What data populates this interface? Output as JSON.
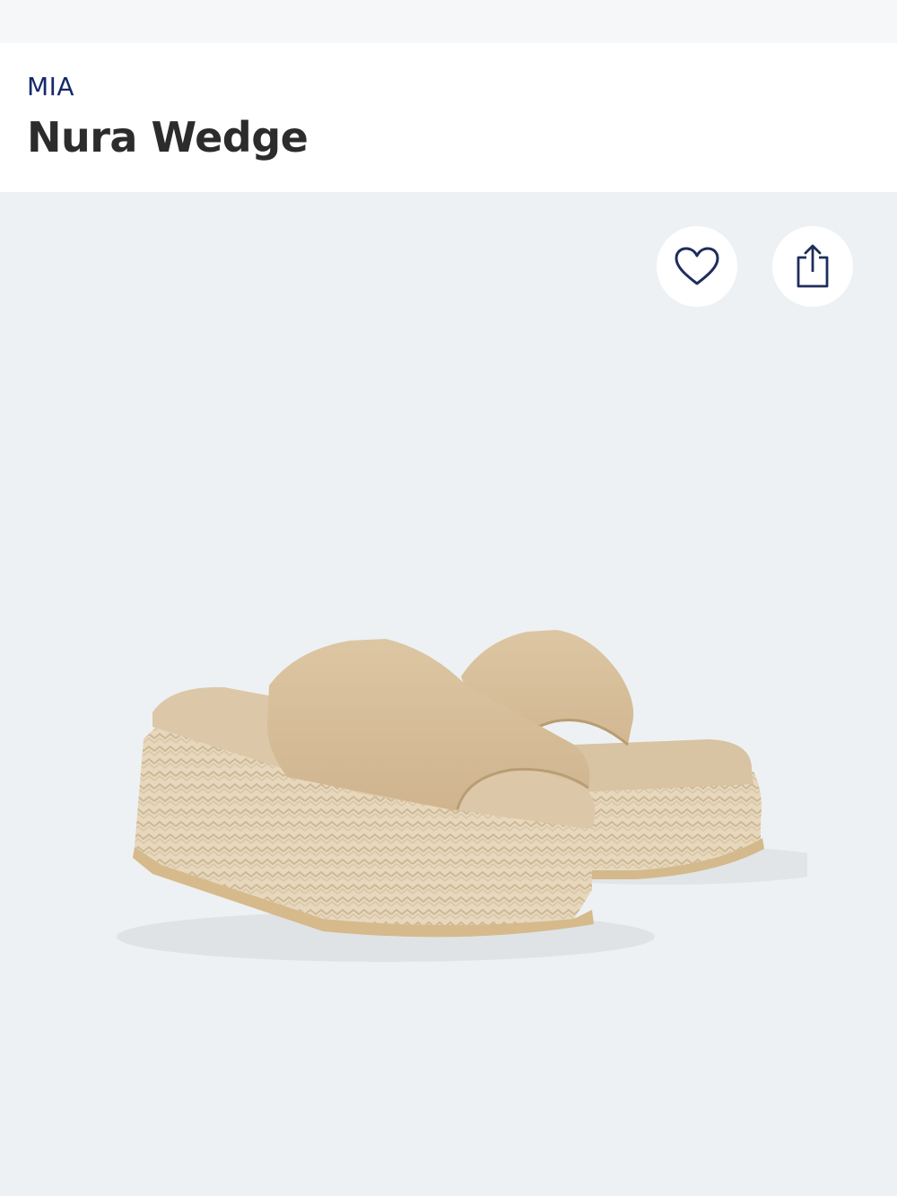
{
  "product": {
    "brand": "MIA",
    "name": "Nura Wedge"
  },
  "actions": {
    "favorite_icon": "heart-outline-icon",
    "share_icon": "share-upload-icon"
  },
  "colors": {
    "brand_text": "#14296b",
    "title_text": "#2c2c2c",
    "image_background": "#edf1f3",
    "icon_stroke": "#1f2d5c"
  }
}
